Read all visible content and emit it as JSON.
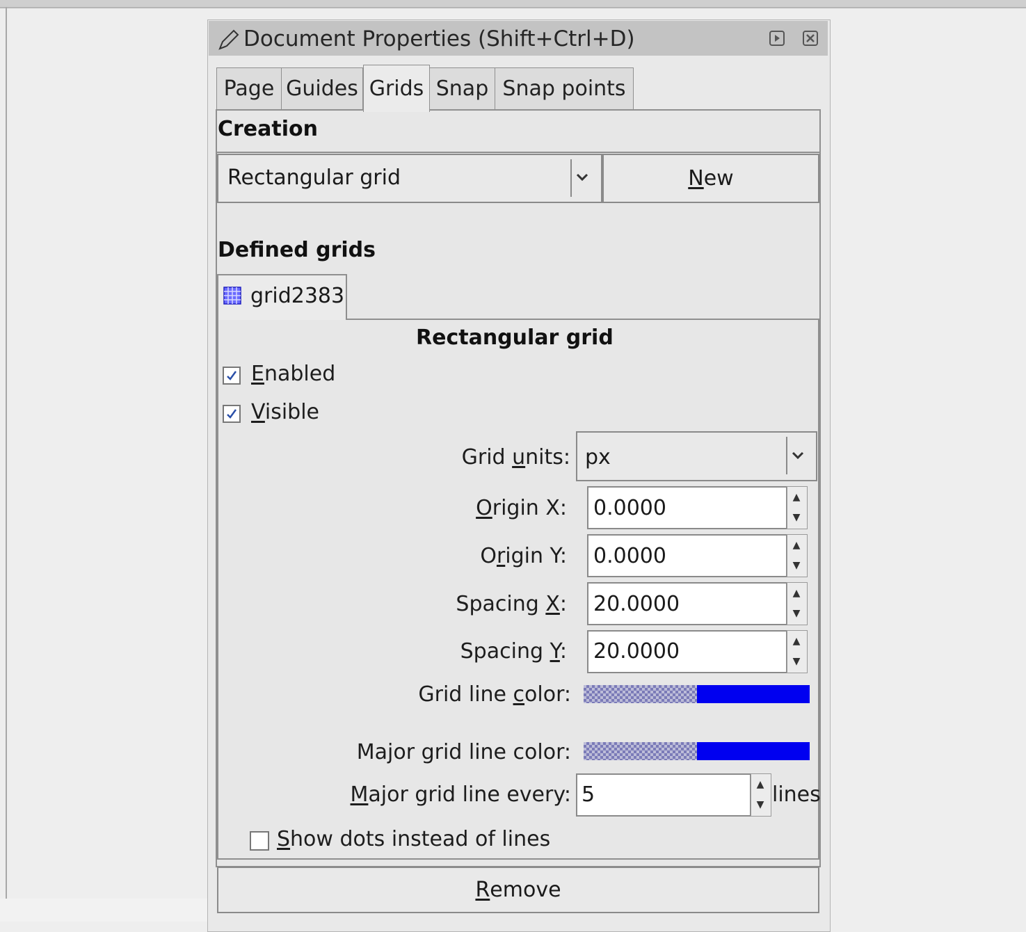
{
  "dialog": {
    "title": "Document Properties (Shift+Ctrl+D)",
    "icons": {
      "app": "pen-icon",
      "dock": "dock-icon",
      "close": "close-icon"
    }
  },
  "tabs": [
    {
      "label": "Page"
    },
    {
      "label": "Guides"
    },
    {
      "label": "Grids",
      "active": true
    },
    {
      "label": "Snap"
    },
    {
      "label": "Snap points"
    }
  ],
  "creation": {
    "heading": "Creation",
    "grid_type_selected": "Rectangular grid",
    "new_button_prefix": "",
    "new_button_accel": "N",
    "new_button_rest": "ew"
  },
  "defined": {
    "heading": "Defined grids",
    "grid_tab_label": "grid2383",
    "grid_tab_icon": "grid-icon",
    "panel_title": "Rectangular grid"
  },
  "options": {
    "enabled": {
      "accel": "E",
      "rest": "nabled",
      "checked": true
    },
    "visible": {
      "accel": "V",
      "rest": "isible",
      "checked": true
    },
    "show_dots": {
      "accel": "S",
      "rest": "how dots instead of lines",
      "checked": false
    }
  },
  "fields": {
    "grid_units": {
      "pre": "Grid ",
      "accel": "u",
      "post": "nits:",
      "value": "px"
    },
    "origin_x": {
      "pre": "",
      "accel": "O",
      "post": "rigin X:",
      "value": "0.0000"
    },
    "origin_y": {
      "pre": "O",
      "accel": "r",
      "post": "igin Y:",
      "value": "0.0000"
    },
    "spacing_x": {
      "pre": "Spacing ",
      "accel": "X",
      "post": ":",
      "value": "20.0000"
    },
    "spacing_y": {
      "pre": "Spacing ",
      "accel": "Y",
      "post": ":",
      "value": "20.0000"
    },
    "grid_line_color": {
      "pre": "Grid line ",
      "accel": "c",
      "post": "olor:",
      "color": "#0000f0"
    },
    "major_grid_line_color": {
      "pre": "Major grid line ",
      "accel": "",
      "post": "color:",
      "color": "#0000f0"
    },
    "major_every": {
      "pre": "",
      "accel": "M",
      "post": "ajor grid line every:",
      "value": "5",
      "suffix": "lines"
    }
  },
  "remove_button": {
    "accel": "R",
    "rest": "emove"
  }
}
